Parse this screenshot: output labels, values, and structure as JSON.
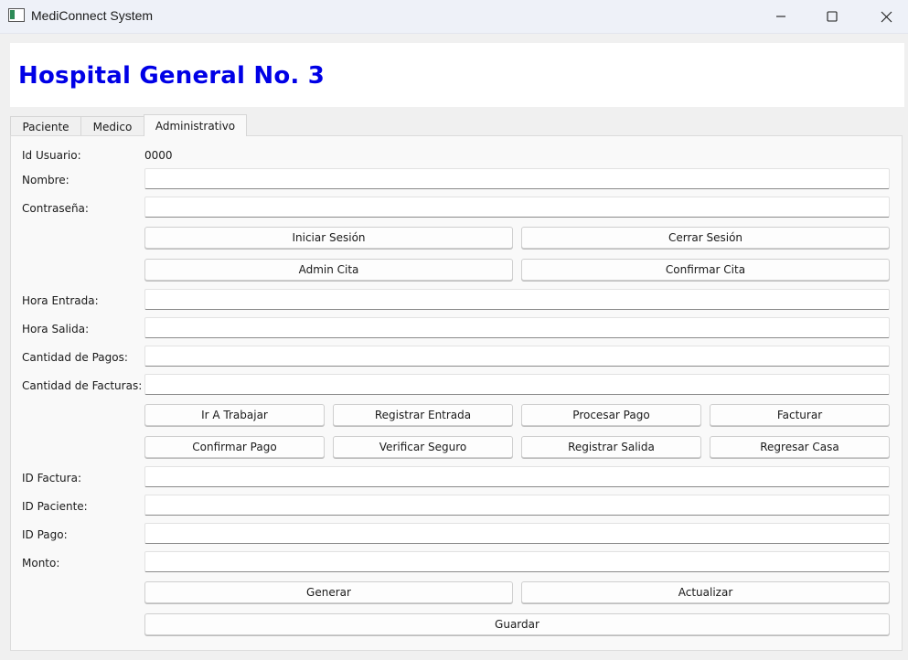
{
  "window": {
    "title": "MediConnect System",
    "icons": {
      "app": "app-window-icon",
      "minimize": "minimize-icon",
      "maximize": "maximize-icon",
      "close": "close-icon"
    }
  },
  "header": {
    "title": "Hospital General No. 3",
    "title_color": "#0000e6"
  },
  "tabs": [
    {
      "label": "Paciente"
    },
    {
      "label": "Medico"
    },
    {
      "label": "Administrativo",
      "active": true
    }
  ],
  "form": {
    "id_usuario": {
      "label": "Id Usuario:",
      "value": "0000"
    },
    "nombre": {
      "label": "Nombre:",
      "value": ""
    },
    "contrasena": {
      "label": "Contraseña:",
      "value": ""
    },
    "hora_entrada": {
      "label": "Hora Entrada:",
      "value": ""
    },
    "hora_salida": {
      "label": "Hora Salida:",
      "value": ""
    },
    "cantidad_pagos": {
      "label": "Cantidad de Pagos:",
      "value": ""
    },
    "cantidad_facturas": {
      "label": "Cantidad de Facturas:",
      "value": ""
    },
    "id_factura": {
      "label": "ID Factura:",
      "value": ""
    },
    "id_paciente": {
      "label": "ID Paciente:",
      "value": ""
    },
    "id_pago": {
      "label": "ID Pago:",
      "value": ""
    },
    "monto": {
      "label": "Monto:",
      "value": ""
    }
  },
  "buttons": {
    "iniciar_sesion": "Iniciar Sesión",
    "cerrar_sesion": "Cerrar Sesión",
    "admin_cita": "Admin Cita",
    "confirmar_cita": "Confirmar Cita",
    "ir_a_trabajar": "Ir A Trabajar",
    "registrar_entrada": "Registrar Entrada",
    "procesar_pago": "Procesar Pago",
    "facturar": "Facturar",
    "confirmar_pago": "Confirmar Pago",
    "verificar_seguro": "Verificar Seguro",
    "registrar_salida": "Registrar Salida",
    "regresar_casa": "Regresar Casa",
    "generar": "Generar",
    "actualizar": "Actualizar",
    "guardar": "Guardar"
  }
}
